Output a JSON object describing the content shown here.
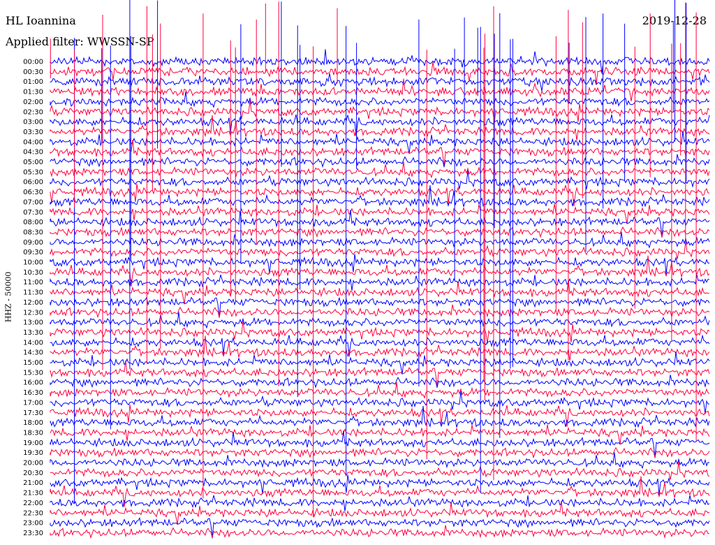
{
  "header": {
    "station": "HL Ioannina",
    "filter": "Applied filter: WWSSN-SP",
    "date": "2019-12-28"
  },
  "chart_data": {
    "type": "line",
    "title": "HL Ioannina",
    "ylabel": "HHZ - 50000",
    "row_labels": [
      "00:00",
      "00:30",
      "01:00",
      "01:30",
      "02:00",
      "02:30",
      "03:00",
      "03:30",
      "04:00",
      "04:30",
      "05:00",
      "05:30",
      "06:00",
      "06:30",
      "07:00",
      "07:30",
      "08:00",
      "08:30",
      "09:00",
      "09:30",
      "10:00",
      "10:30",
      "11:00",
      "11:30",
      "12:00",
      "12:30",
      "13:00",
      "13:30",
      "14:00",
      "14:30",
      "15:00",
      "15:30",
      "16:00",
      "16:30",
      "17:00",
      "17:30",
      "18:00",
      "18:30",
      "19:00",
      "19:30",
      "20:00",
      "20:30",
      "21:00",
      "21:30",
      "22:00",
      "22:30",
      "23:00",
      "23:30"
    ],
    "row_colors": [
      "#0000ff",
      "#ff0040"
    ],
    "grid": false
  }
}
